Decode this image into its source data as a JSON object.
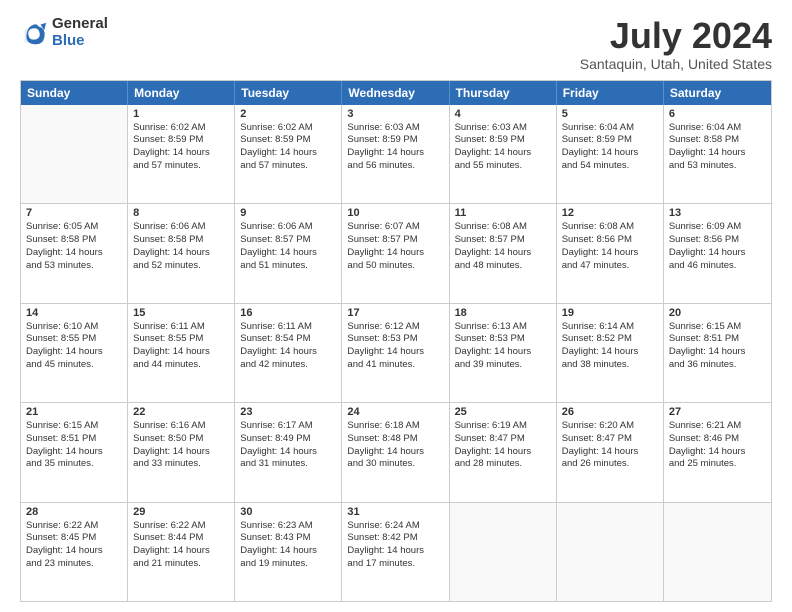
{
  "logo": {
    "general": "General",
    "blue": "Blue"
  },
  "title": "July 2024",
  "subtitle": "Santaquin, Utah, United States",
  "header_days": [
    "Sunday",
    "Monday",
    "Tuesday",
    "Wednesday",
    "Thursday",
    "Friday",
    "Saturday"
  ],
  "rows": [
    [
      {
        "day": "",
        "lines": []
      },
      {
        "day": "1",
        "lines": [
          "Sunrise: 6:02 AM",
          "Sunset: 8:59 PM",
          "Daylight: 14 hours",
          "and 57 minutes."
        ]
      },
      {
        "day": "2",
        "lines": [
          "Sunrise: 6:02 AM",
          "Sunset: 8:59 PM",
          "Daylight: 14 hours",
          "and 57 minutes."
        ]
      },
      {
        "day": "3",
        "lines": [
          "Sunrise: 6:03 AM",
          "Sunset: 8:59 PM",
          "Daylight: 14 hours",
          "and 56 minutes."
        ]
      },
      {
        "day": "4",
        "lines": [
          "Sunrise: 6:03 AM",
          "Sunset: 8:59 PM",
          "Daylight: 14 hours",
          "and 55 minutes."
        ]
      },
      {
        "day": "5",
        "lines": [
          "Sunrise: 6:04 AM",
          "Sunset: 8:59 PM",
          "Daylight: 14 hours",
          "and 54 minutes."
        ]
      },
      {
        "day": "6",
        "lines": [
          "Sunrise: 6:04 AM",
          "Sunset: 8:58 PM",
          "Daylight: 14 hours",
          "and 53 minutes."
        ]
      }
    ],
    [
      {
        "day": "7",
        "lines": [
          "Sunrise: 6:05 AM",
          "Sunset: 8:58 PM",
          "Daylight: 14 hours",
          "and 53 minutes."
        ]
      },
      {
        "day": "8",
        "lines": [
          "Sunrise: 6:06 AM",
          "Sunset: 8:58 PM",
          "Daylight: 14 hours",
          "and 52 minutes."
        ]
      },
      {
        "day": "9",
        "lines": [
          "Sunrise: 6:06 AM",
          "Sunset: 8:57 PM",
          "Daylight: 14 hours",
          "and 51 minutes."
        ]
      },
      {
        "day": "10",
        "lines": [
          "Sunrise: 6:07 AM",
          "Sunset: 8:57 PM",
          "Daylight: 14 hours",
          "and 50 minutes."
        ]
      },
      {
        "day": "11",
        "lines": [
          "Sunrise: 6:08 AM",
          "Sunset: 8:57 PM",
          "Daylight: 14 hours",
          "and 48 minutes."
        ]
      },
      {
        "day": "12",
        "lines": [
          "Sunrise: 6:08 AM",
          "Sunset: 8:56 PM",
          "Daylight: 14 hours",
          "and 47 minutes."
        ]
      },
      {
        "day": "13",
        "lines": [
          "Sunrise: 6:09 AM",
          "Sunset: 8:56 PM",
          "Daylight: 14 hours",
          "and 46 minutes."
        ]
      }
    ],
    [
      {
        "day": "14",
        "lines": [
          "Sunrise: 6:10 AM",
          "Sunset: 8:55 PM",
          "Daylight: 14 hours",
          "and 45 minutes."
        ]
      },
      {
        "day": "15",
        "lines": [
          "Sunrise: 6:11 AM",
          "Sunset: 8:55 PM",
          "Daylight: 14 hours",
          "and 44 minutes."
        ]
      },
      {
        "day": "16",
        "lines": [
          "Sunrise: 6:11 AM",
          "Sunset: 8:54 PM",
          "Daylight: 14 hours",
          "and 42 minutes."
        ]
      },
      {
        "day": "17",
        "lines": [
          "Sunrise: 6:12 AM",
          "Sunset: 8:53 PM",
          "Daylight: 14 hours",
          "and 41 minutes."
        ]
      },
      {
        "day": "18",
        "lines": [
          "Sunrise: 6:13 AM",
          "Sunset: 8:53 PM",
          "Daylight: 14 hours",
          "and 39 minutes."
        ]
      },
      {
        "day": "19",
        "lines": [
          "Sunrise: 6:14 AM",
          "Sunset: 8:52 PM",
          "Daylight: 14 hours",
          "and 38 minutes."
        ]
      },
      {
        "day": "20",
        "lines": [
          "Sunrise: 6:15 AM",
          "Sunset: 8:51 PM",
          "Daylight: 14 hours",
          "and 36 minutes."
        ]
      }
    ],
    [
      {
        "day": "21",
        "lines": [
          "Sunrise: 6:15 AM",
          "Sunset: 8:51 PM",
          "Daylight: 14 hours",
          "and 35 minutes."
        ]
      },
      {
        "day": "22",
        "lines": [
          "Sunrise: 6:16 AM",
          "Sunset: 8:50 PM",
          "Daylight: 14 hours",
          "and 33 minutes."
        ]
      },
      {
        "day": "23",
        "lines": [
          "Sunrise: 6:17 AM",
          "Sunset: 8:49 PM",
          "Daylight: 14 hours",
          "and 31 minutes."
        ]
      },
      {
        "day": "24",
        "lines": [
          "Sunrise: 6:18 AM",
          "Sunset: 8:48 PM",
          "Daylight: 14 hours",
          "and 30 minutes."
        ]
      },
      {
        "day": "25",
        "lines": [
          "Sunrise: 6:19 AM",
          "Sunset: 8:47 PM",
          "Daylight: 14 hours",
          "and 28 minutes."
        ]
      },
      {
        "day": "26",
        "lines": [
          "Sunrise: 6:20 AM",
          "Sunset: 8:47 PM",
          "Daylight: 14 hours",
          "and 26 minutes."
        ]
      },
      {
        "day": "27",
        "lines": [
          "Sunrise: 6:21 AM",
          "Sunset: 8:46 PM",
          "Daylight: 14 hours",
          "and 25 minutes."
        ]
      }
    ],
    [
      {
        "day": "28",
        "lines": [
          "Sunrise: 6:22 AM",
          "Sunset: 8:45 PM",
          "Daylight: 14 hours",
          "and 23 minutes."
        ]
      },
      {
        "day": "29",
        "lines": [
          "Sunrise: 6:22 AM",
          "Sunset: 8:44 PM",
          "Daylight: 14 hours",
          "and 21 minutes."
        ]
      },
      {
        "day": "30",
        "lines": [
          "Sunrise: 6:23 AM",
          "Sunset: 8:43 PM",
          "Daylight: 14 hours",
          "and 19 minutes."
        ]
      },
      {
        "day": "31",
        "lines": [
          "Sunrise: 6:24 AM",
          "Sunset: 8:42 PM",
          "Daylight: 14 hours",
          "and 17 minutes."
        ]
      },
      {
        "day": "",
        "lines": []
      },
      {
        "day": "",
        "lines": []
      },
      {
        "day": "",
        "lines": []
      }
    ]
  ]
}
